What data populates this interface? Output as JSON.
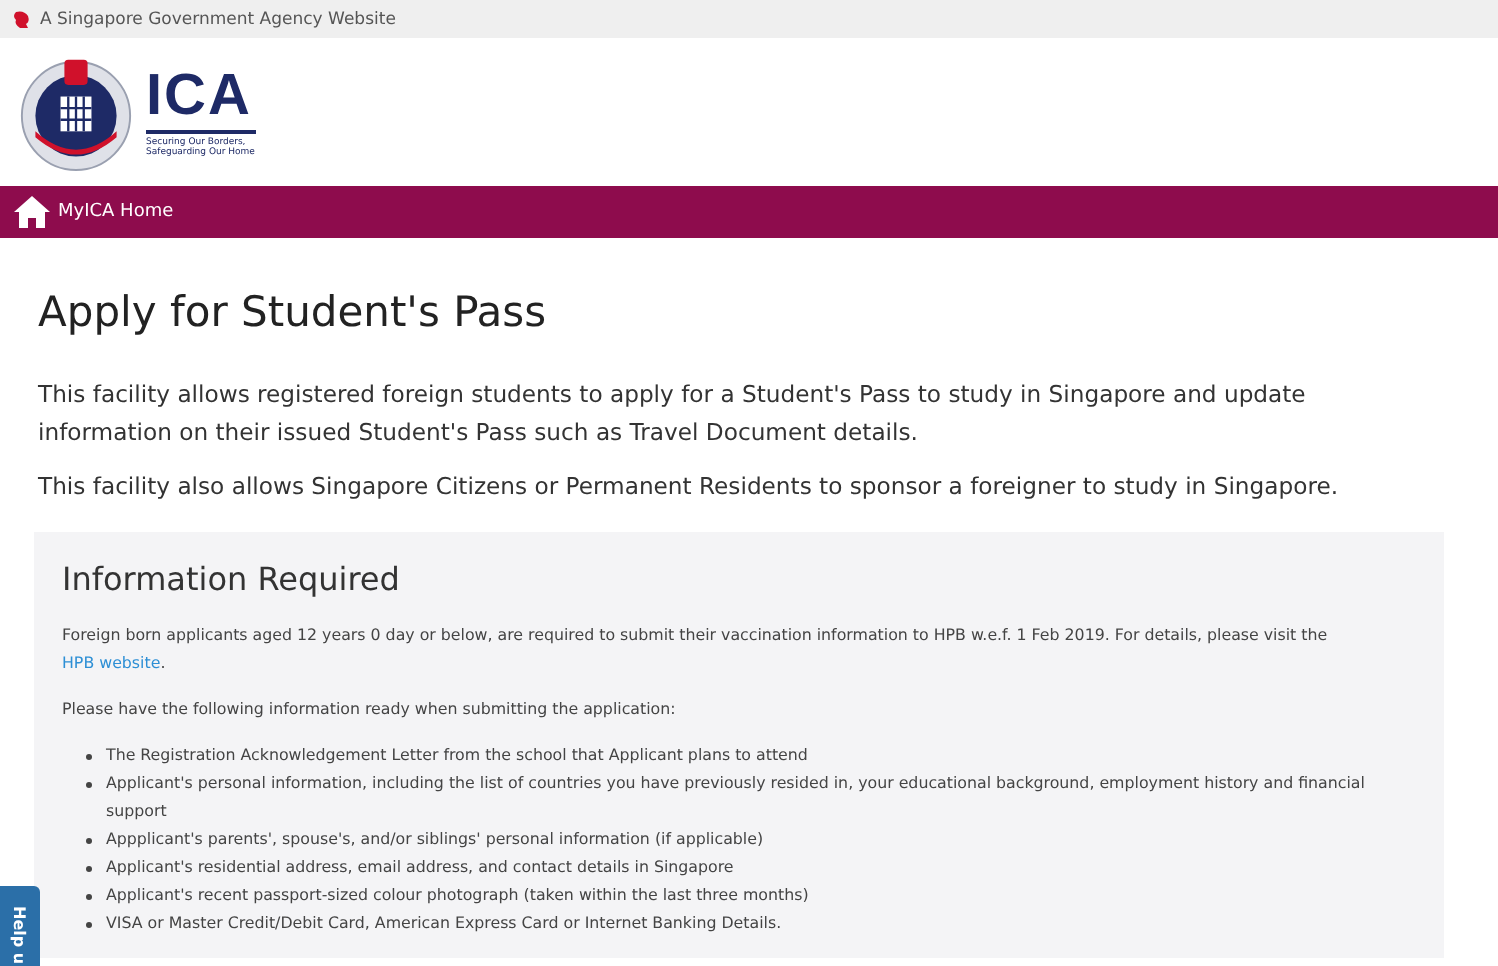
{
  "banner": {
    "text": "A Singapore Government Agency Website"
  },
  "logo": {
    "name": "ICA",
    "tagline_lines": [
      "Securing Our Borders,",
      "Safeguarding Our Home"
    ]
  },
  "nav": {
    "home_label": "MyICA Home"
  },
  "title": "Apply for Student's Pass",
  "intro": [
    "This facility allows registered foreign students to apply for a Student's Pass to study in Singapore and update information on their issued Student's Pass such as Travel Document details.",
    "This facility also allows Singapore Citizens or Permanent Residents to sponsor a foreigner to study in Singapore."
  ],
  "info": {
    "heading": "Information Required",
    "notice": "Foreign born applicants aged 12 years 0 day or below, are required to submit their vaccination information to HPB w.e.f. 1 Feb 2019. For details, please visit the",
    "link": "HPB website",
    "link_suffix": ".",
    "lead": "Please have the following information ready when submitting the application:",
    "items": [
      "The Registration Acknowledgement Letter from the school that Applicant plans to attend",
      "Applicant's personal information, including the list of countries you have previously resided in, your educational background, employment history and financial support",
      "Appplicant's parents', spouse's, and/or siblings' personal information (if applicable)",
      "Applicant's residential address, email address, and contact details in Singapore",
      "Applicant's recent passport-sized colour photograph (taken within the last three months)",
      "VISA or Master Credit/Debit Card, American Express Card or Internet Banking Details."
    ]
  },
  "help_tab": {
    "label": "Help u"
  }
}
